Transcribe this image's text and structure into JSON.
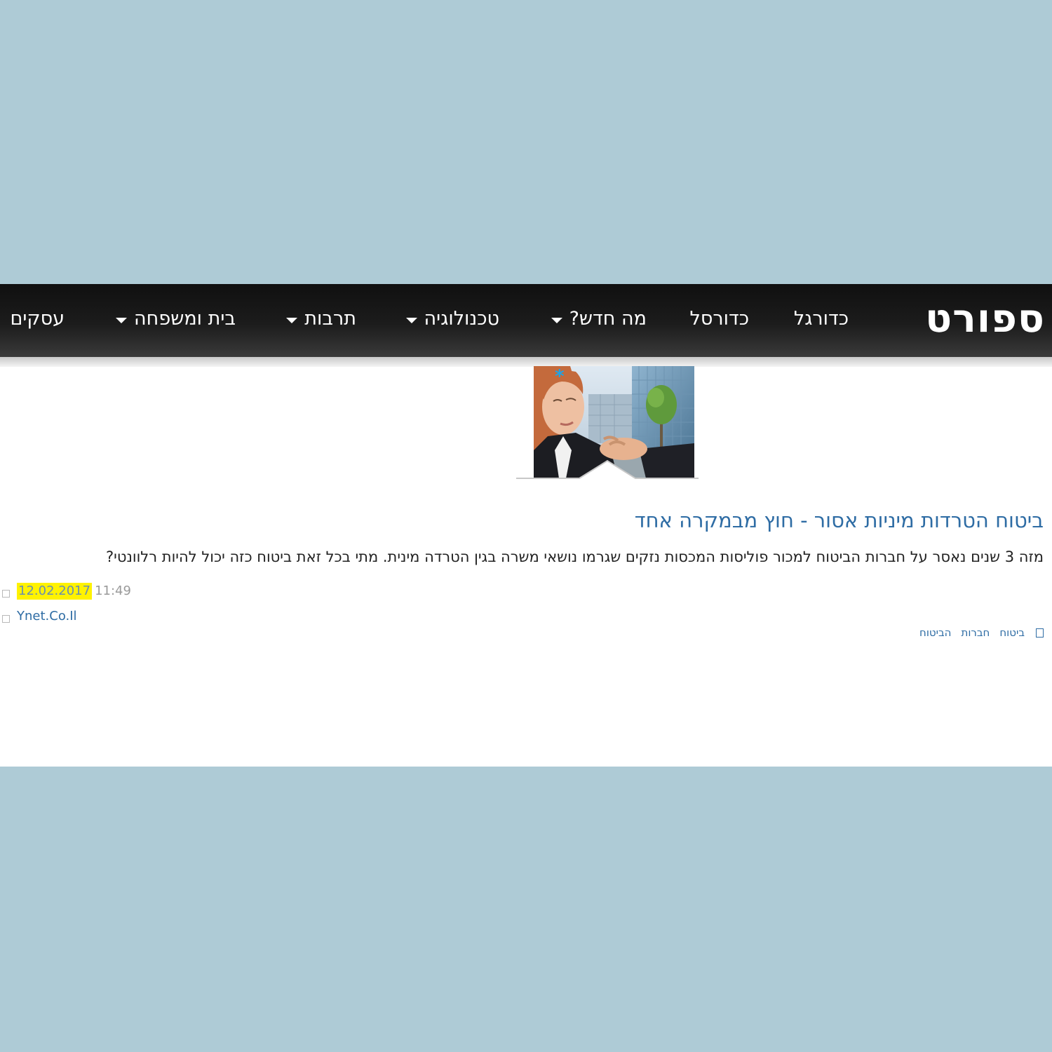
{
  "navbar": {
    "brand": "ספורט",
    "items": [
      {
        "label": "כדורגל",
        "has_dropdown": false
      },
      {
        "label": "כדורסל",
        "has_dropdown": false
      },
      {
        "label": "מה חדש?",
        "has_dropdown": true
      },
      {
        "label": "טכנולוגיה",
        "has_dropdown": true
      },
      {
        "label": "תרבות",
        "has_dropdown": true
      },
      {
        "label": "בית ומשפחה",
        "has_dropdown": true
      },
      {
        "label": "עסקים",
        "has_dropdown": false
      }
    ]
  },
  "article": {
    "title": "ביטוח הטרדות מיניות אסור - חוץ מבמקרה אחד",
    "summary": "מזה 3 שנים נאסר על חברות הביטוח למכור פוליסות המכסות נזקים שגרמו נושאי משרה בגין הטרדה מינית. מתי בכל זאת ביטוח כזה יכול להיות רלוונטי?",
    "date": "12.02.2017",
    "time": "11:49",
    "source": "Ynet.Co.Il",
    "tags": [
      "ביטוח",
      "חברות",
      "הביטוח"
    ]
  },
  "colors": {
    "background": "#aecbd6",
    "navbar": "#1c1c1c",
    "link": "#2e6ca4",
    "date_highlight": "#fff200",
    "star": "#1fa3e6"
  }
}
